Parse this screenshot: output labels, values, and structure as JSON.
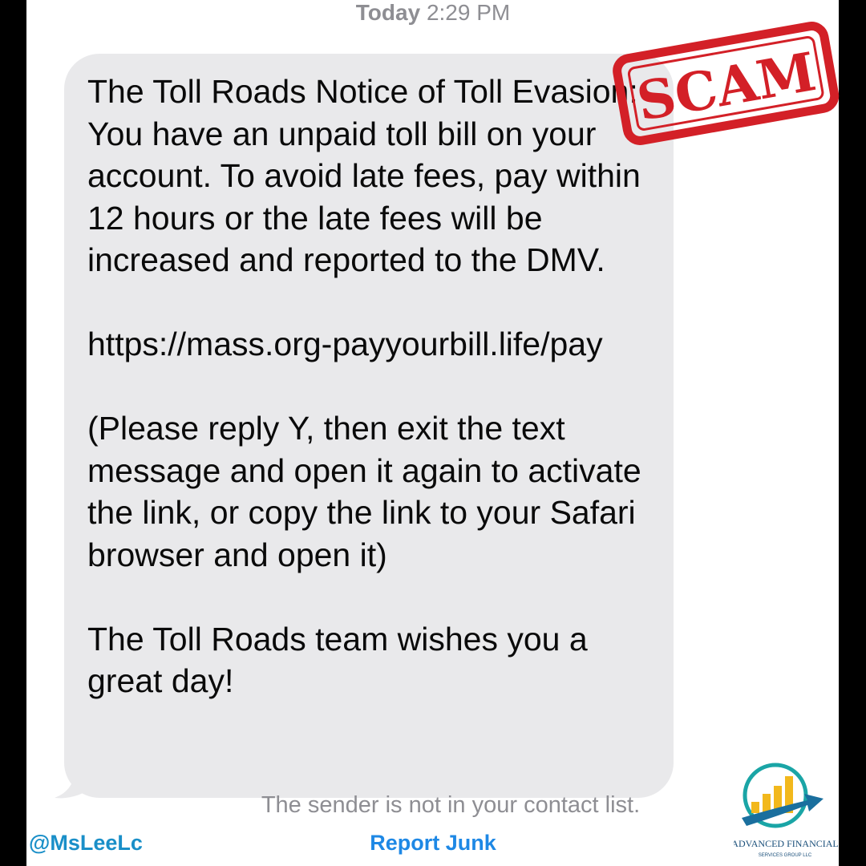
{
  "header": {
    "timestamp_day": "Today",
    "timestamp_time": "2:29 PM"
  },
  "message": {
    "paragraph1": "The Toll Roads Notice of Toll Evasion: You have an unpaid toll bill on your account. To avoid late fees, pay within 12 hours or the late fees will be increased and reported to the DMV.",
    "link": "https://mass.org-payyourbill.life/pay",
    "paragraph3": "(Please reply Y, then exit the text message and open it again to activate the link, or copy the link to your Safari browser and open it)",
    "paragraph4": "The Toll Roads team wishes you a great day!"
  },
  "footer": {
    "notice": "The sender is not in your contact list.",
    "report_label": "Report Junk",
    "handle": "@MsLeeLc"
  },
  "overlay": {
    "stamp_text": "SCAM",
    "stamp_color": "#d32027",
    "logo_text_line1": "ADVANCED FINANCIAL",
    "logo_text_line2": "SERVICES GROUP LLC"
  },
  "colors": {
    "bubble": "#e9e9eb",
    "link_blue": "#1e88e5",
    "secondary_text": "#8e8e93"
  }
}
